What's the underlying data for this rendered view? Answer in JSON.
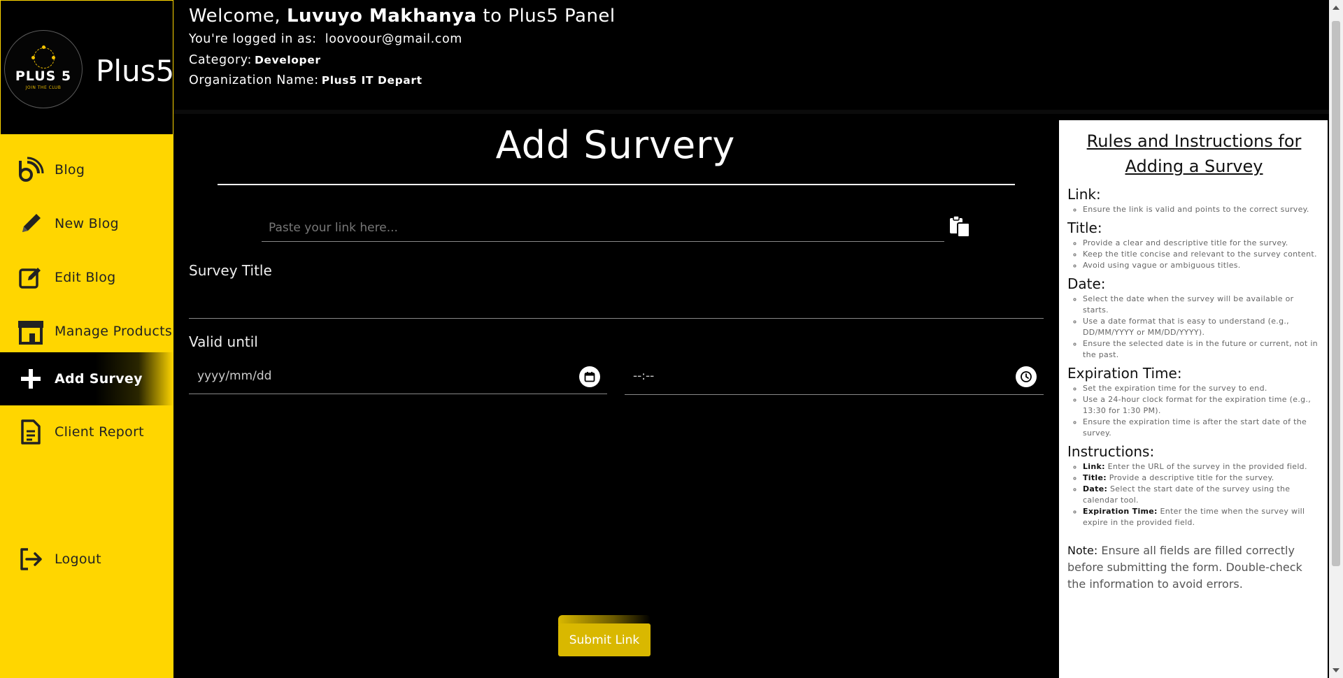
{
  "brand": {
    "logo_text": "PLUS 5",
    "logo_tagline": "JOIN THE CLUB",
    "name": "Plus5"
  },
  "header": {
    "welcome_prefix": "Welcome,",
    "user_name": "Luvuyo Makhanya",
    "welcome_suffix": "to Plus5 Panel",
    "logged_label": "You're logged in as:",
    "email": "loovoour@gmail.com",
    "category_label": "Category:",
    "category": "Developer",
    "org_label": "Organization Name:",
    "org": "Plus5 IT Depart"
  },
  "sidebar": {
    "items": [
      {
        "label": "Blog",
        "icon": "blog-feed-icon"
      },
      {
        "label": "New Blog",
        "icon": "pencil-icon"
      },
      {
        "label": "Edit Blog",
        "icon": "edit-square-icon"
      },
      {
        "label": "Manage Products",
        "icon": "store-icon"
      },
      {
        "label": "Add Survey",
        "icon": "plus-icon",
        "active": true
      },
      {
        "label": "Client Report",
        "icon": "document-icon"
      }
    ],
    "logout": {
      "label": "Logout",
      "icon": "logout-icon"
    }
  },
  "form": {
    "title": "Add Survery",
    "link_placeholder": "Paste your link here...",
    "survey_title_label": "Survey Title",
    "valid_until_label": "Valid until",
    "date_placeholder": "yyyy/mm/dd",
    "time_placeholder": "--:--",
    "submit_label": "Submit Link"
  },
  "rules": {
    "title": "Rules and Instructions for Adding a Survey",
    "sections": [
      {
        "heading": "Link:",
        "items": [
          "Ensure the link is valid and points to the correct survey."
        ]
      },
      {
        "heading": "Title:",
        "items": [
          "Provide a clear and descriptive title for the survey.",
          "Keep the title concise and relevant to the survey content.",
          "Avoid using vague or ambiguous titles."
        ]
      },
      {
        "heading": "Date:",
        "items": [
          "Select the date when the survey will be available or starts.",
          "Use a date format that is easy to understand (e.g., DD/MM/YYYY or MM/DD/YYYY).",
          "Ensure the selected date is in the future or current, not in the past."
        ]
      },
      {
        "heading": "Expiration Time:",
        "items": [
          "Set the expiration time for the survey to end.",
          "Use a 24-hour clock format for the expiration time (e.g., 13:30 for 1:30 PM).",
          "Ensure the expiration time is after the start date of the survey."
        ]
      }
    ],
    "instructions_heading": "Instructions:",
    "instructions": [
      {
        "key": "Link:",
        "text": "Enter the URL of the survey in the provided field."
      },
      {
        "key": "Title:",
        "text": "Provide a descriptive title for the survey."
      },
      {
        "key": "Date:",
        "text": "Select the start date of the survey using the calendar tool."
      },
      {
        "key": "Expiration Time:",
        "text": "Enter the time when the survey will expire in the provided field."
      }
    ],
    "note_label": "Note:",
    "note_text": "Ensure all fields are filled correctly before submitting the form. Double-check the information to avoid errors."
  },
  "colors": {
    "accent": "#ffd600",
    "submit": "#d9b800",
    "background": "#000000"
  }
}
